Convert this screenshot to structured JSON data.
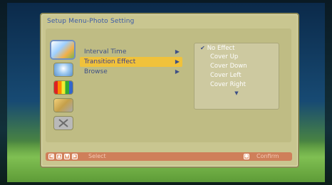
{
  "window": {
    "title": "Setup Menu-Photo Setting"
  },
  "sidebar": {
    "icons": [
      {
        "name": "photo-icon",
        "active": true
      },
      {
        "name": "globe-icon",
        "active": false
      },
      {
        "name": "color-bars-icon",
        "active": false
      },
      {
        "name": "tools-icon",
        "active": false
      },
      {
        "name": "exit-icon",
        "active": false
      }
    ]
  },
  "menu": {
    "items": [
      {
        "label": "Interval Time",
        "arrow": "▶"
      },
      {
        "label": "Transition Effect",
        "arrow": "▶",
        "selected": true
      },
      {
        "label": "Browse",
        "arrow": "▶"
      }
    ]
  },
  "submenu": {
    "items": [
      {
        "label": "No Effect",
        "checked": true
      },
      {
        "label": "Cover Up"
      },
      {
        "label": "Cover Down"
      },
      {
        "label": "Cover Left"
      },
      {
        "label": "Cover Right"
      }
    ],
    "more_indicator": "▼"
  },
  "footer": {
    "select_label": "Select",
    "confirm_label": "Confirm"
  },
  "colors": {
    "panel": "#c9c690",
    "highlight": "#f0c23b",
    "footer": "#cf7f5a",
    "title": "#3b5aa8"
  }
}
